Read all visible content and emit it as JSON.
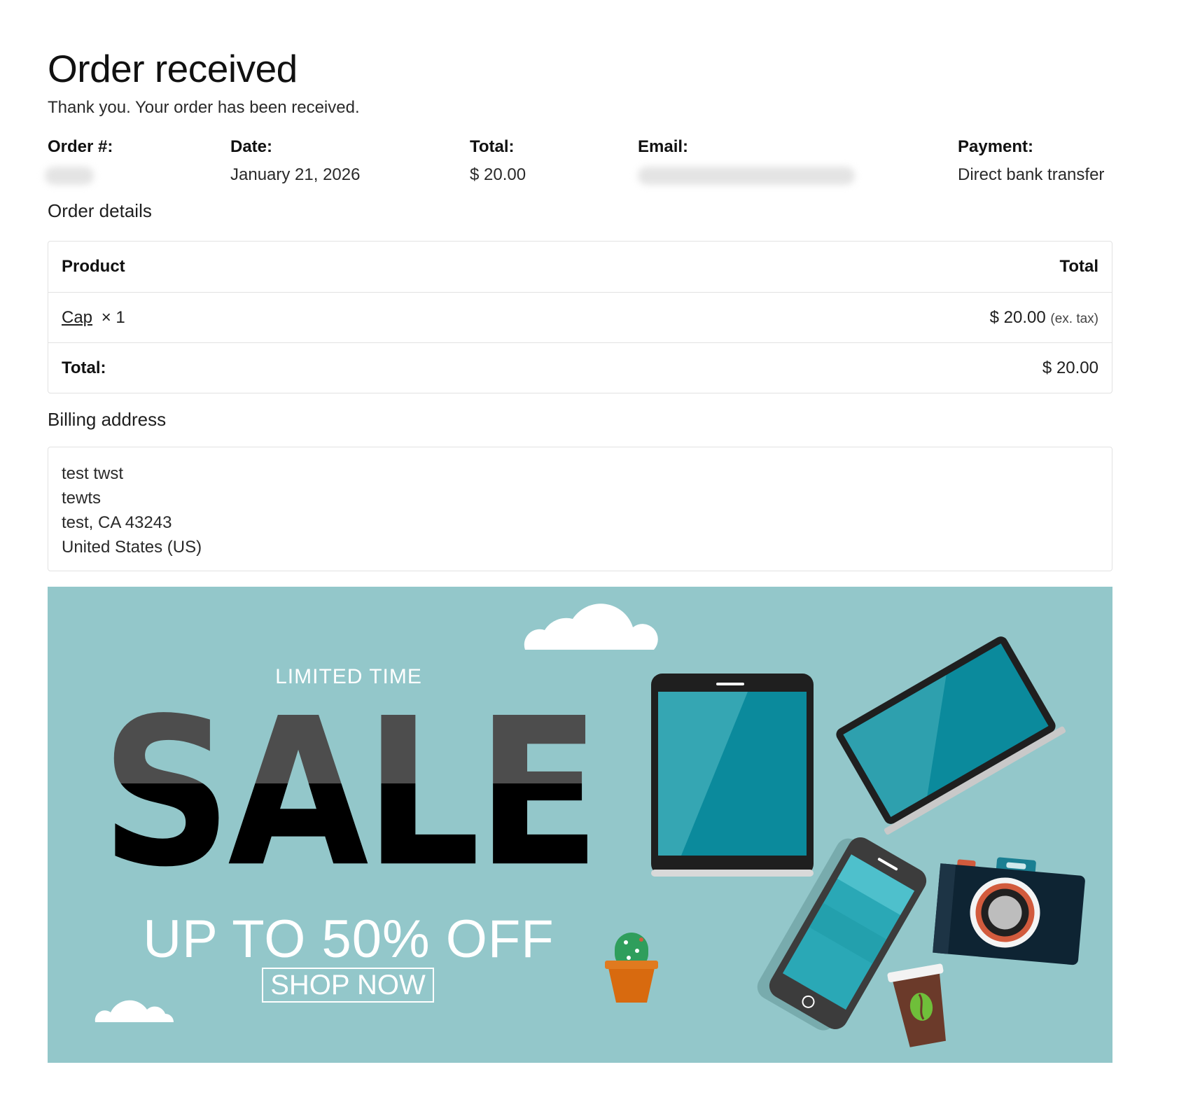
{
  "page": {
    "title": "Order received",
    "thank_you": "Thank you. Your order has been received."
  },
  "overview": {
    "order_label": "Order #:",
    "date_label": "Date:",
    "date_value": "January 21, 2026",
    "total_label": "Total:",
    "total_value": "$ 20.00",
    "email_label": "Email:",
    "payment_label": "Payment:",
    "payment_value": "Direct bank transfer"
  },
  "order_details": {
    "heading": "Order details",
    "col_product": "Product",
    "col_total": "Total",
    "items": [
      {
        "name": "Cap",
        "qty": "× 1",
        "price": "$ 20.00",
        "tax_note": "(ex. tax)"
      }
    ],
    "total_label": "Total:",
    "total_value": "$ 20.00"
  },
  "billing": {
    "heading": "Billing address",
    "lines": [
      "test twst",
      "tewts",
      "test, CA 43243",
      "United States (US)"
    ]
  },
  "banner": {
    "limited": "LIMITED TIME",
    "sale": "SALE",
    "offer": "UP TO 50% OFF",
    "cta": "SHOP NOW",
    "colors": {
      "background": "#93c7ca",
      "screen": "#0b8a9c",
      "pot": "#d86a0f"
    }
  }
}
